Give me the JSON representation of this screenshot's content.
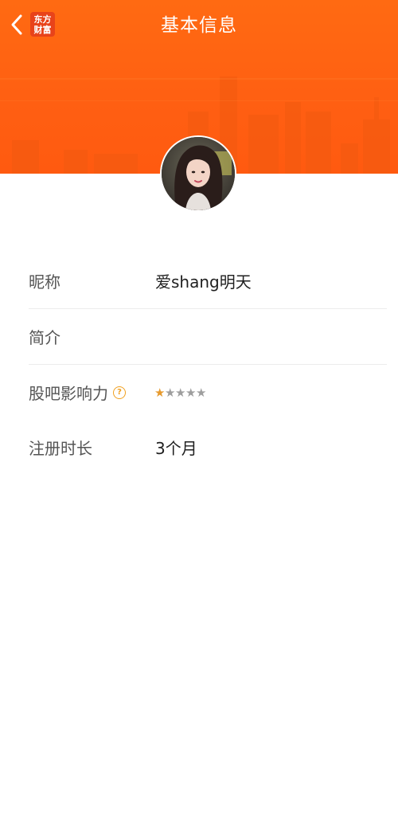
{
  "header": {
    "title": "基本信息",
    "back_icon": "chevron-left-icon",
    "logo_line1": "东方",
    "logo_line2": "财富",
    "brand_color": "#ff6312"
  },
  "profile": {
    "avatar_alt": "user avatar"
  },
  "fields": {
    "nickname_label": "昵称",
    "nickname_value": "爱shang明天",
    "intro_label": "简介",
    "intro_value": "",
    "influence_label": "股吧影响力",
    "influence_help_icon": "question-circle-icon",
    "influence_stars_filled": 1,
    "influence_stars_total": 5,
    "registration_label": "注册时长",
    "registration_value": "3个月"
  },
  "colors": {
    "star_on": "#e69a2e",
    "star_off": "#9e9e9e",
    "help_icon": "#f0a020"
  }
}
